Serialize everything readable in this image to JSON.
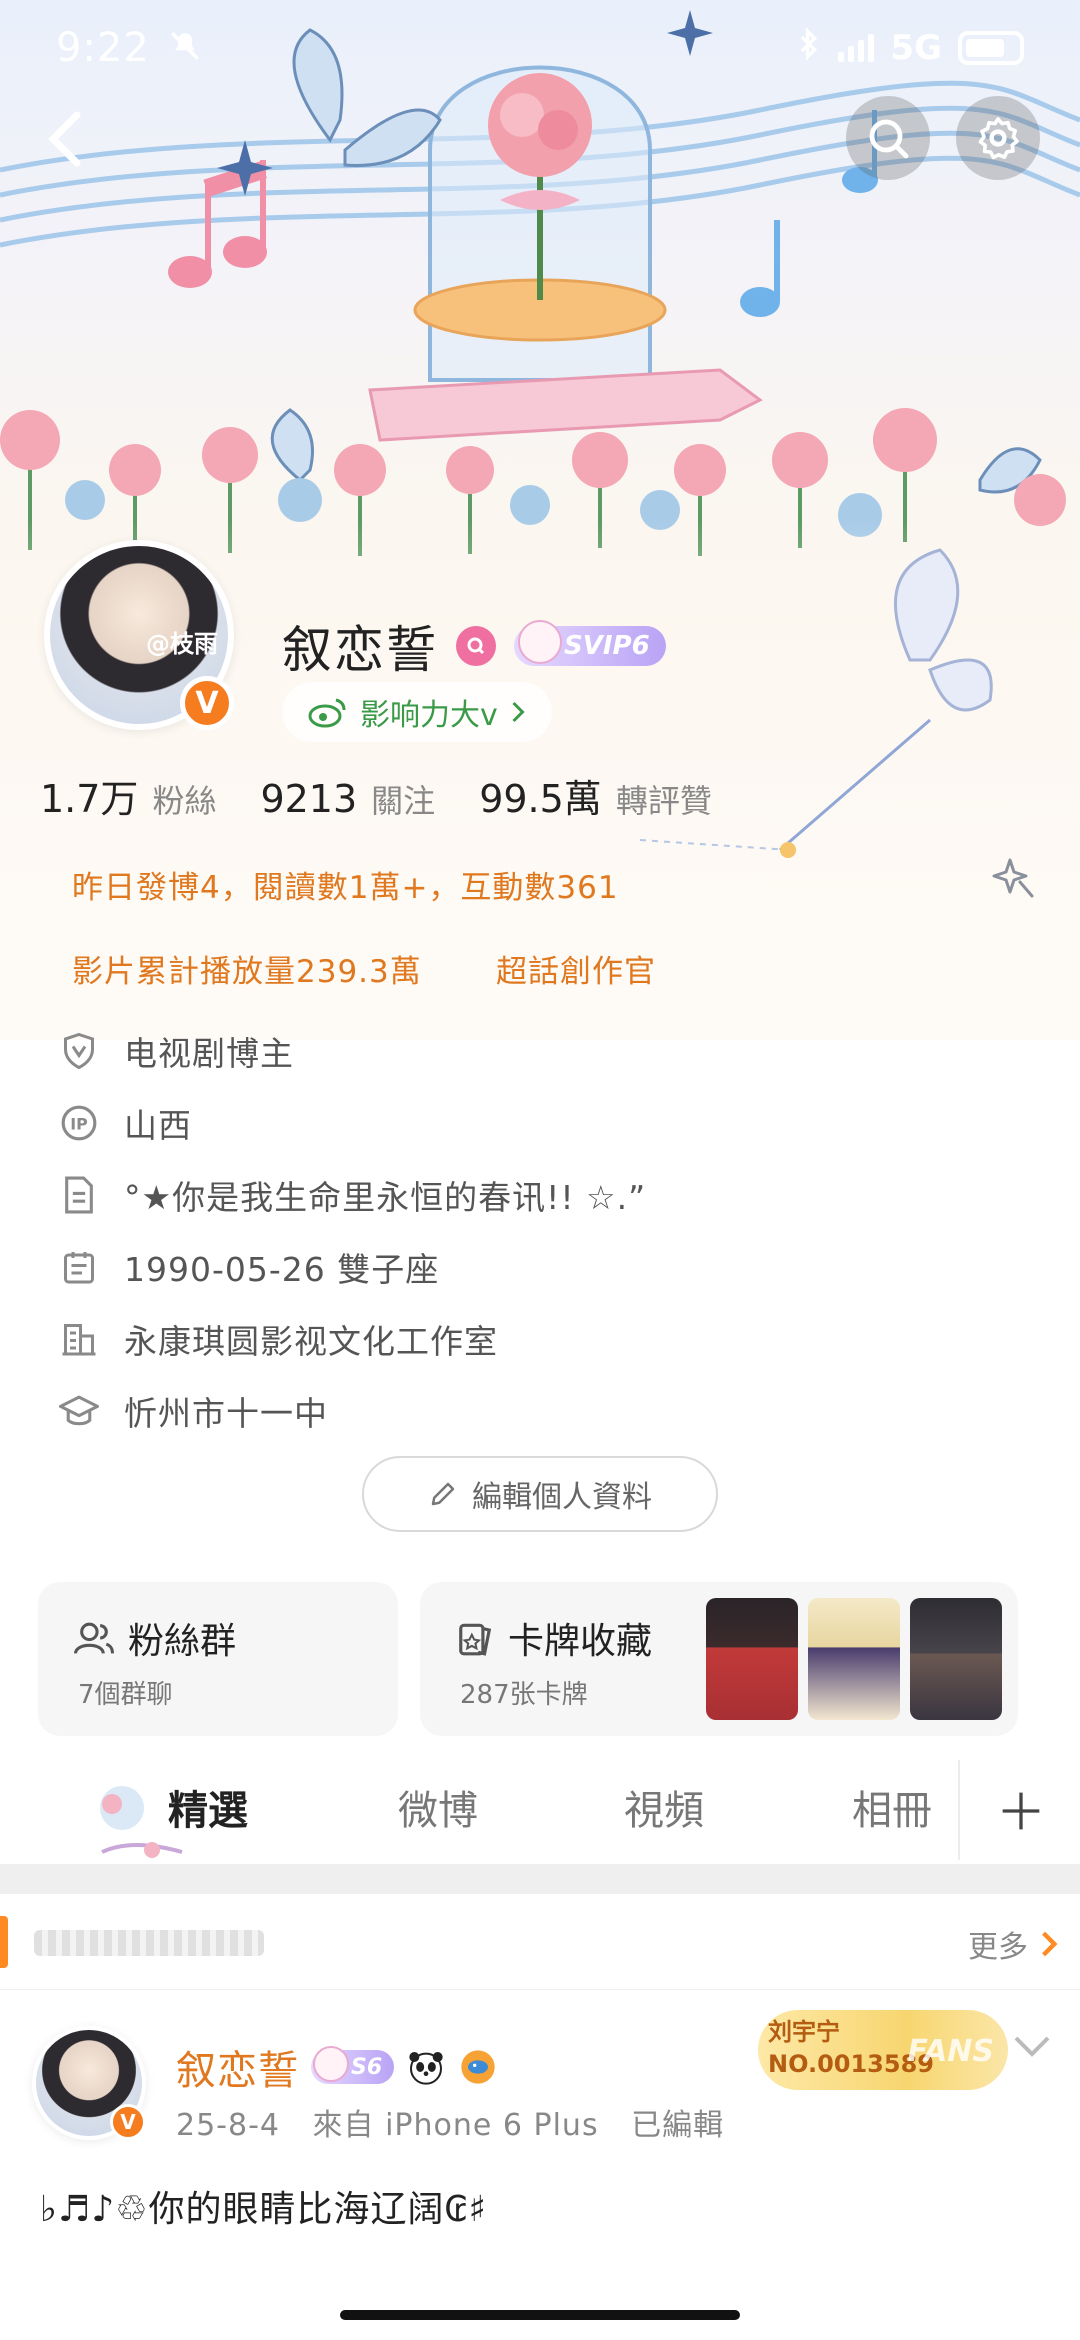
{
  "status_bar": {
    "time": "9:22",
    "network": "5G"
  },
  "header": {
    "back_icon": "back-chevron-icon",
    "search_icon": "search-icon",
    "settings_icon": "gear-icon"
  },
  "profile": {
    "avatar_tag": "@枝雨",
    "name": "叙恋誓",
    "svip_badge": "SVIP6",
    "influence_label": "影响力大v",
    "stats": [
      {
        "value": "1.7万",
        "label": "粉絲"
      },
      {
        "value": "9213",
        "label": "關注"
      },
      {
        "value": "99.5萬",
        "label": "轉評贊"
      }
    ],
    "highlights": {
      "line1": "昨日發博4，閱讀數1萬+，互動數361",
      "video_plays": "影片累計播放量239.3萬",
      "super_topic": "超話創作官"
    },
    "info": [
      {
        "icon": "shield-icon",
        "text": "电视剧博主"
      },
      {
        "icon": "ip-icon",
        "text": "山西"
      },
      {
        "icon": "document-icon",
        "text": "°★你是我生命里永恒的春讯!! ☆.”"
      },
      {
        "icon": "calendar-icon",
        "text": "1990-05-26 雙子座"
      },
      {
        "icon": "building-icon",
        "text": "永康琪圆影视文化工作室"
      },
      {
        "icon": "graduation-cap-icon",
        "text": "忻州市十一中"
      }
    ],
    "edit_button": "編輯個人資料"
  },
  "cards": {
    "fan_group": {
      "title": "粉絲群",
      "subtitle": "7個群聊"
    },
    "card_collection": {
      "title": "卡牌收藏",
      "subtitle": "287张卡牌"
    }
  },
  "tabs": [
    {
      "label": "精選",
      "active": true
    },
    {
      "label": "微博",
      "active": false
    },
    {
      "label": "視頻",
      "active": false
    },
    {
      "label": "相冊",
      "active": false
    }
  ],
  "pinned": {
    "more": "更多"
  },
  "post": {
    "author": "叙恋誓",
    "level_badge": "S6",
    "date": "25-8-4",
    "source": "來自 iPhone 6 Plus",
    "edited": "已編輯",
    "fans_card": {
      "name": "刘宇宁",
      "number": "NO.0013589",
      "word": "FANS"
    },
    "text": "♭♬♪♲你的眼睛比海辽阔₢♯"
  },
  "colors": {
    "accent_orange": "#e0781f",
    "influence_green": "#3a9a47",
    "vip_purple": "#b9a3f5"
  }
}
